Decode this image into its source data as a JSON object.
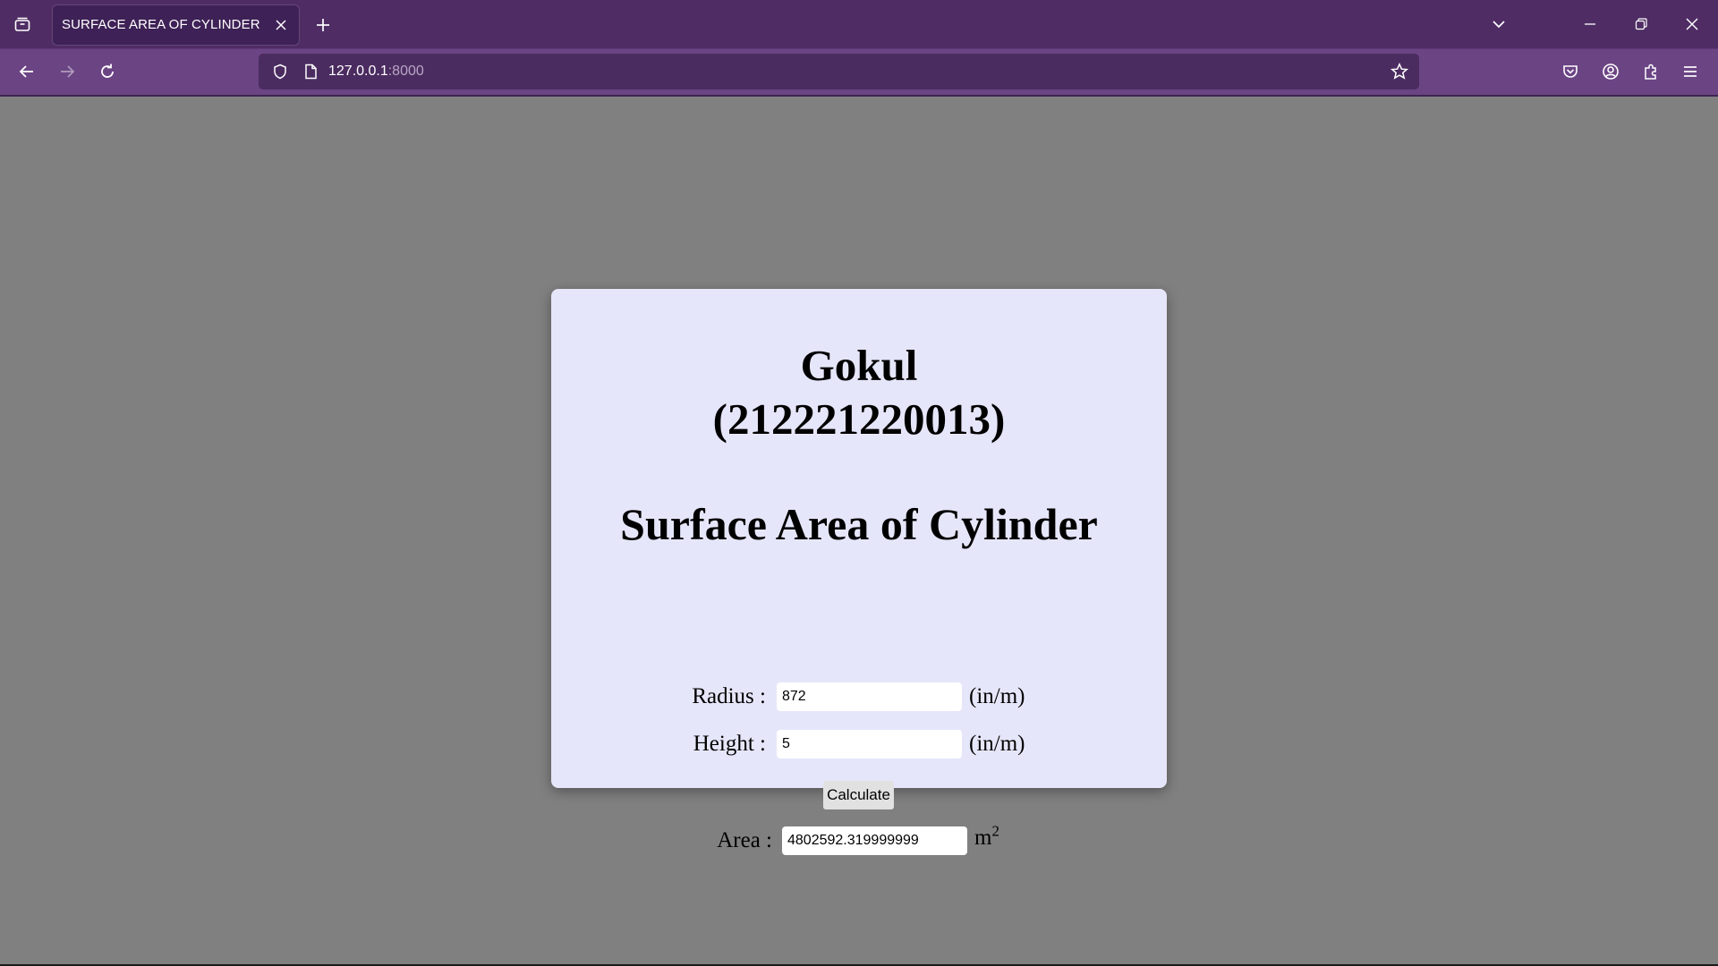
{
  "browser": {
    "tab_title": "SURFACE AREA OF CYLINDER",
    "url_host": "127.0.0.1",
    "url_port": ":8000"
  },
  "page": {
    "author_name": "Gokul",
    "author_id": "(212221220013)",
    "heading": "Surface Area of Cylinder",
    "radius_label": "Radius :",
    "radius_value": "872",
    "radius_unit": "(in/m)",
    "height_label": "Height :",
    "height_value": "5",
    "height_unit": "(in/m)",
    "calculate_label": "Calculate",
    "area_label": "Area :",
    "area_value": "4802592.319999999",
    "area_unit_base": "m",
    "area_unit_exp": "2"
  },
  "colors": {
    "tabbar": "#4f2d64",
    "navbar": "#6b4484",
    "page_background": "#808080",
    "card_background": "#e6e6fa"
  }
}
